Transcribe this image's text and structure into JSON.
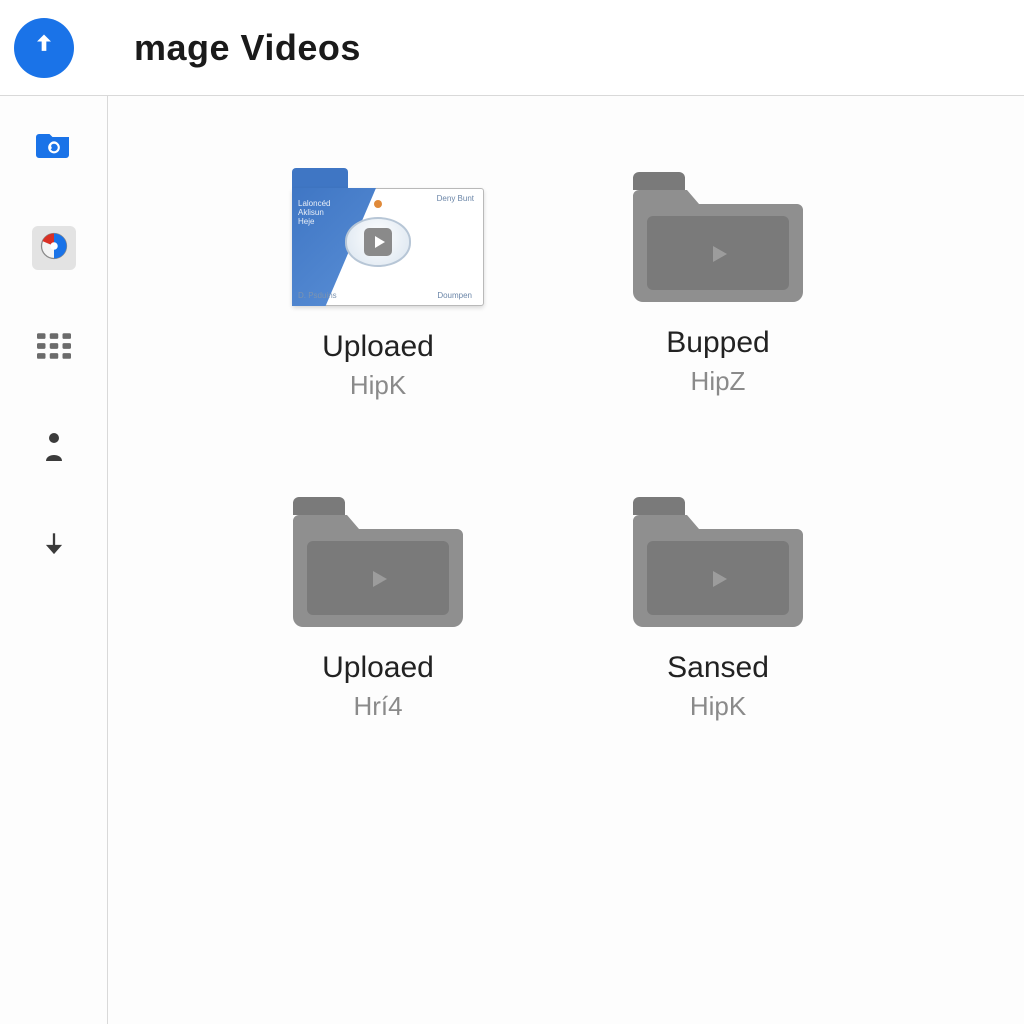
{
  "header": {
    "title": "mage Videos"
  },
  "sidebar": {
    "items": [
      {
        "name": "folder-icon",
        "active": true
      },
      {
        "name": "disc-icon",
        "active": false
      },
      {
        "name": "grid-icon",
        "active": false
      },
      {
        "name": "person-icon",
        "active": false
      },
      {
        "name": "download-icon",
        "active": false
      }
    ]
  },
  "thumbnail_text": {
    "swoosh_line1": "Laloncéd",
    "swoosh_line2": "Aklisun",
    "swoosh_line3": "Heje",
    "corner_tr": "Deny Bunt",
    "corner_bl": "D. Psduins",
    "corner_br": "Doumpen"
  },
  "items": [
    {
      "kind": "video-folder",
      "title": "Uploaed",
      "subtitle": "HipK"
    },
    {
      "kind": "folder",
      "title": "Bupped",
      "subtitle": "HipZ"
    },
    {
      "kind": "folder",
      "title": "Uploaed",
      "subtitle": "Hrí4"
    },
    {
      "kind": "folder",
      "title": "Sansed",
      "subtitle": "HipK"
    }
  ],
  "colors": {
    "accent": "#1a73e8",
    "folder": "#8f8f8f",
    "folder_dark": "#7a7a7a"
  }
}
